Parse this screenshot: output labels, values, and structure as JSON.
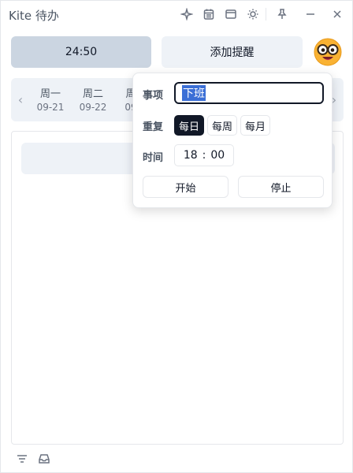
{
  "app": {
    "title": "Kite 待办"
  },
  "titlebar": {
    "icons": [
      "sparkle-icon",
      "calendar-icon",
      "window-icon",
      "sun-icon",
      "pin-icon",
      "minimize-icon",
      "close-icon"
    ]
  },
  "toolbar": {
    "timer_label": "24:50",
    "reminder_label": "添加提醒"
  },
  "week": {
    "days": [
      {
        "name": "周一",
        "date": "09-21"
      },
      {
        "name": "周二",
        "date": "09-22"
      },
      {
        "name": "周",
        "date": "09"
      }
    ]
  },
  "reminder_popover": {
    "task_label": "事项",
    "task_value": "下班",
    "repeat_label": "重复",
    "repeat_options": [
      "每日",
      "每周",
      "每月"
    ],
    "repeat_selected": "每日",
    "time_label": "时间",
    "time_hour": "18",
    "time_sep": ":",
    "time_minute": "00",
    "start_label": "开始",
    "stop_label": "停止"
  },
  "bottom": {
    "icons": [
      "filter-icon",
      "inbox-icon"
    ]
  }
}
